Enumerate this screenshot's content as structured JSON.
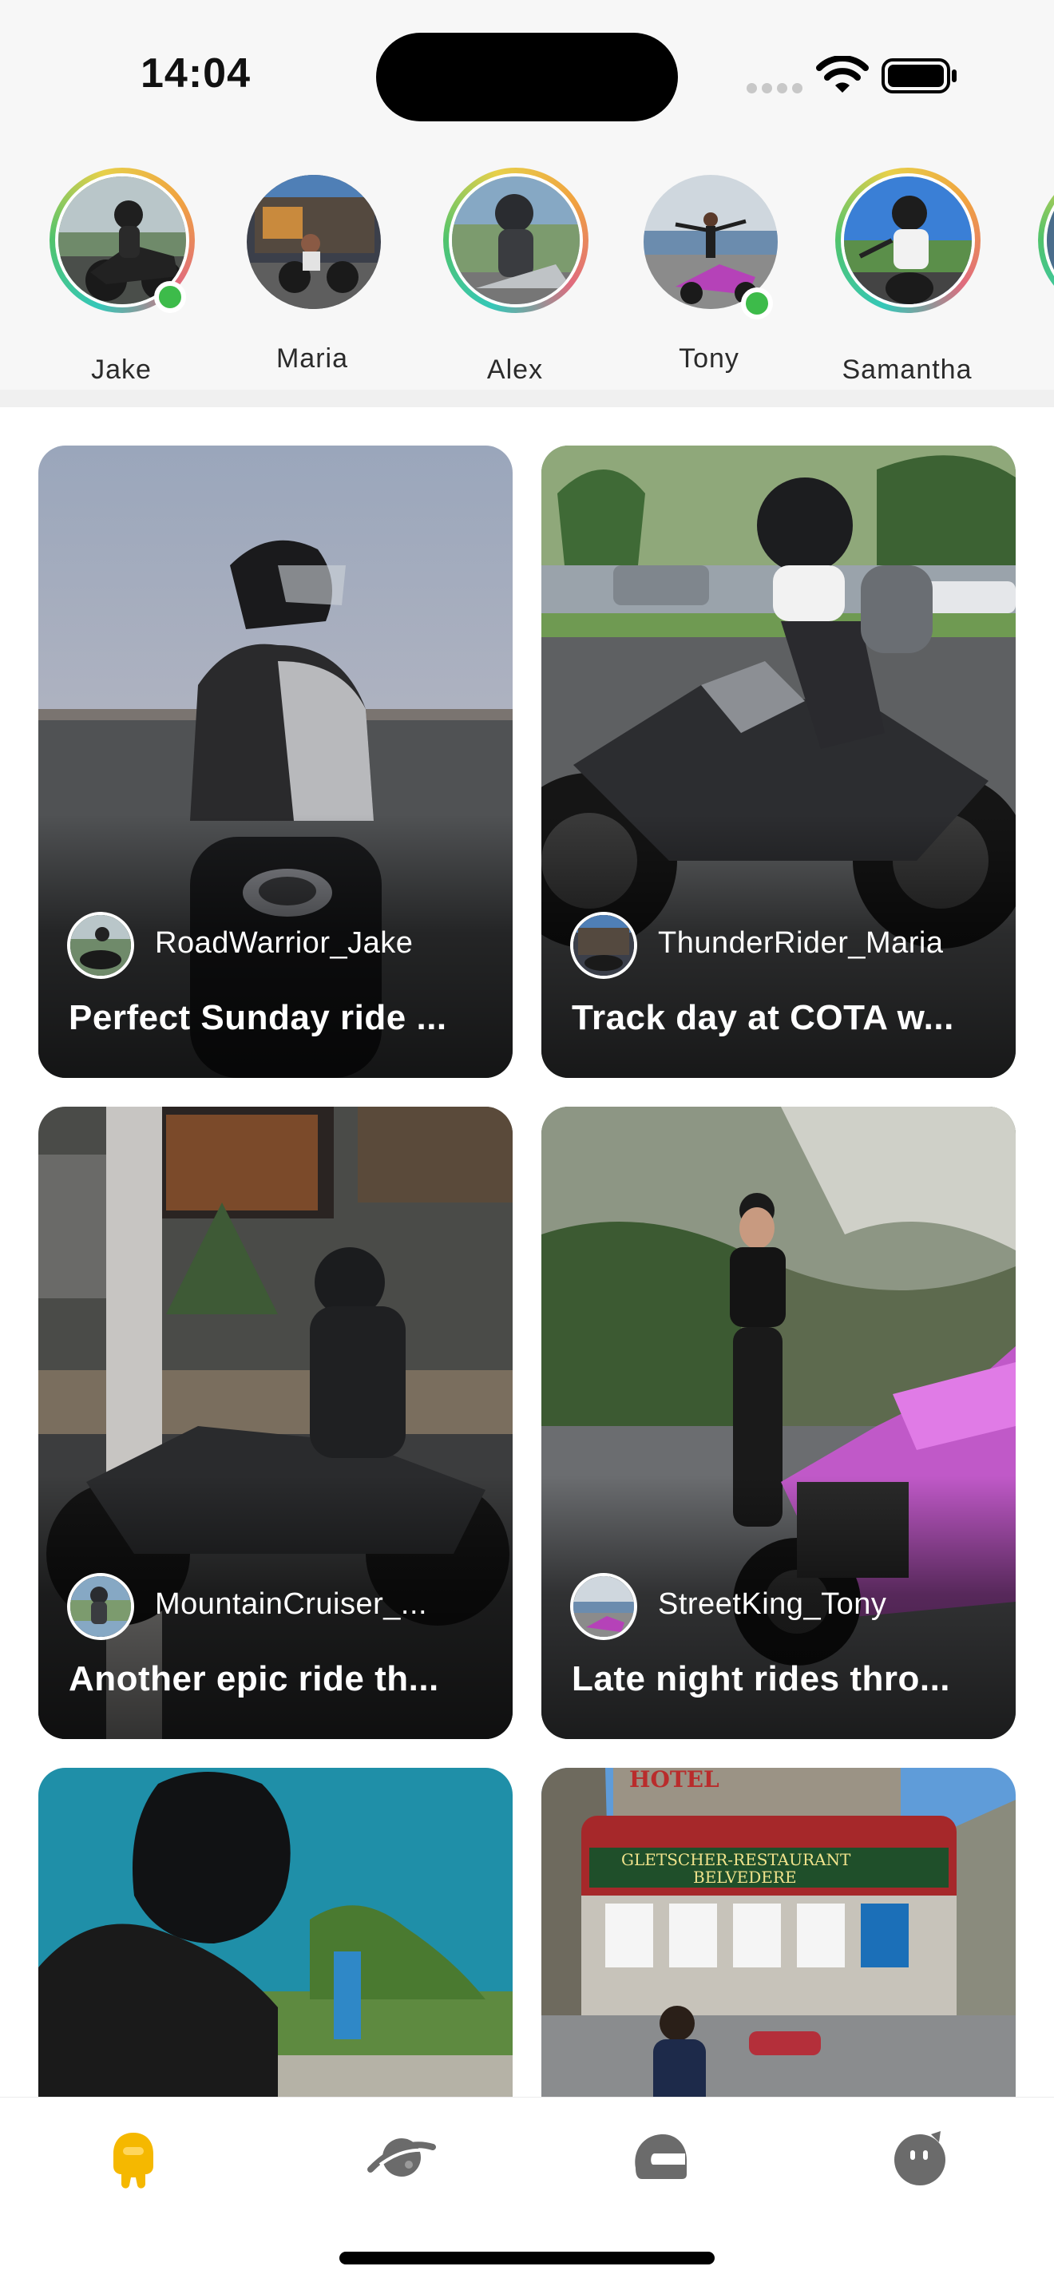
{
  "status_bar": {
    "time": "14:04"
  },
  "stories": [
    {
      "name": "Jake",
      "online": true,
      "ring": true
    },
    {
      "name": "Maria",
      "online": false,
      "ring": false
    },
    {
      "name": "Alex",
      "online": false,
      "ring": true
    },
    {
      "name": "Tony",
      "online": true,
      "ring": false
    },
    {
      "name": "Samantha",
      "online": false,
      "ring": true
    }
  ],
  "feed": {
    "cards": [
      {
        "user": "RoadWarrior_Jake",
        "caption": "Perfect Sunday ride ..."
      },
      {
        "user": "ThunderRider_Maria",
        "caption": "Track day at COTA w..."
      },
      {
        "user": "MountainCruiser_...",
        "caption": "Another epic ride th..."
      },
      {
        "user": "StreetKing_Tony",
        "caption": "Late night rides thro..."
      },
      {
        "user": "",
        "caption": ""
      },
      {
        "user": "",
        "caption": ""
      }
    ],
    "sign_texts": {
      "hotel_sign": "HOTEL",
      "restaurant_sign_line1": "GLETSCHER-RESTAURANT",
      "restaurant_sign_line2": "BELVEDERE"
    }
  },
  "tab_bar": {
    "tabs": [
      {
        "icon": "home-rider-icon",
        "active": true
      },
      {
        "icon": "planet-icon",
        "active": false
      },
      {
        "icon": "helmet-icon",
        "active": false
      },
      {
        "icon": "profile-face-icon",
        "active": false
      }
    ],
    "active_color": "#f5b800",
    "inactive_color": "#6b6b6b"
  }
}
